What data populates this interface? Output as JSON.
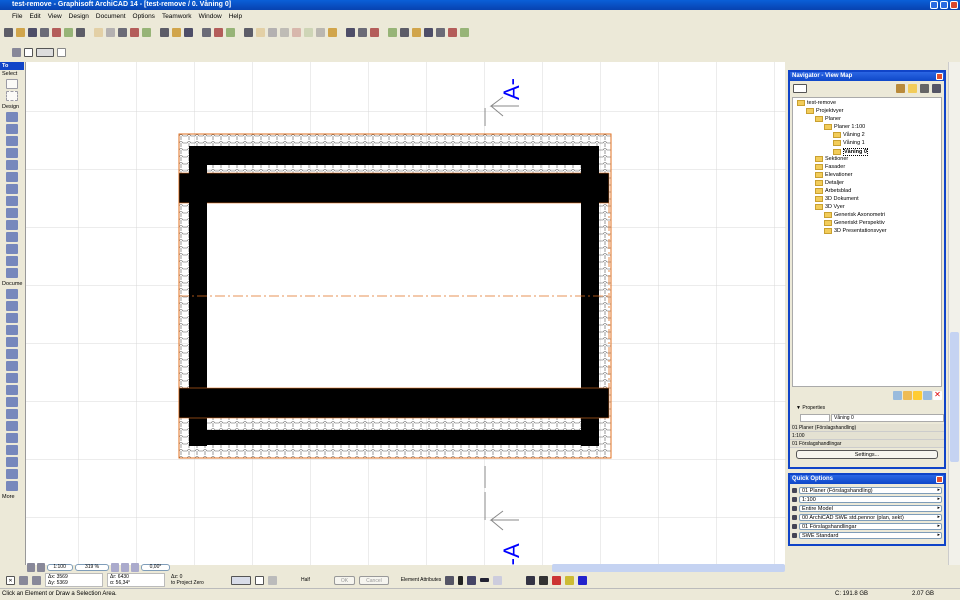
{
  "window": {
    "title": "test-remove - Graphisoft ArchiCAD 14 - [test-remove / 0. Våning 0]"
  },
  "menu": [
    "File",
    "Edit",
    "View",
    "Design",
    "Document",
    "Options",
    "Teamwork",
    "Window",
    "Help"
  ],
  "toolbox": {
    "title": "To",
    "select": "Select",
    "design": "Design",
    "document": "Docume",
    "more": "More"
  },
  "drawing": {
    "section_top": "A-",
    "section_bottom": "A-A",
    "accent": "#0000ff",
    "outline": "#e07020"
  },
  "navigator": {
    "title": "Navigator - View Map",
    "tree": [
      {
        "label": "test-remove",
        "level": 0
      },
      {
        "label": "Projektvyer",
        "level": 1
      },
      {
        "label": "Planer",
        "level": 2
      },
      {
        "label": "Planer 1:100",
        "level": 3
      },
      {
        "label": "Våning 2",
        "level": 4
      },
      {
        "label": "Våning 1",
        "level": 4
      },
      {
        "label": "Våning 0",
        "level": 4,
        "selected": true
      },
      {
        "label": "Sektioner",
        "level": 2
      },
      {
        "label": "Fasader",
        "level": 2
      },
      {
        "label": "Elevationer",
        "level": 2
      },
      {
        "label": "Detaljer",
        "level": 2
      },
      {
        "label": "Arbetsblad",
        "level": 2
      },
      {
        "label": "3D Dokument",
        "level": 2
      },
      {
        "label": "3D Vyer",
        "level": 2
      },
      {
        "label": "Generisk Axonometri",
        "level": 3
      },
      {
        "label": "Generiskt Perspektiv",
        "level": 3
      },
      {
        "label": "3D Presentationsvyer",
        "level": 3
      }
    ],
    "properties_label": "Properties",
    "name_value": "Våning 0",
    "layer_combo": "01 Planer (Förslagshandling)",
    "scale": "1:100",
    "layout": "01 Förslagshandlingar",
    "settings_button": "Settings..."
  },
  "quick_options": {
    "title": "Quick Options",
    "items": [
      "01 Planer (Förslagshandling)",
      "1:100",
      "Entire Model",
      "00 ArchiCAD SWE std.pennor (plan, sekt)",
      "01 Förslagshandlingar",
      "SWE Standard"
    ]
  },
  "zoom": {
    "scale": "1:100",
    "zoom": "319 %",
    "angle": "0,00°"
  },
  "info": {
    "dx": "Δx: 3569",
    "dy": "Δy: 5369",
    "dr": "Δr: 6430",
    "da": "α: 56,34°",
    "dz": "Δz: 0",
    "ref": "to Project Zero",
    "snap": "Half",
    "ok": "OK",
    "cancel": "Cancel",
    "element_attributes": "Element Attributes"
  },
  "status": {
    "message": "Click an Element or Draw a Selection Area.",
    "disk": "C: 191.8 GB",
    "memory": "2.07 GB"
  }
}
